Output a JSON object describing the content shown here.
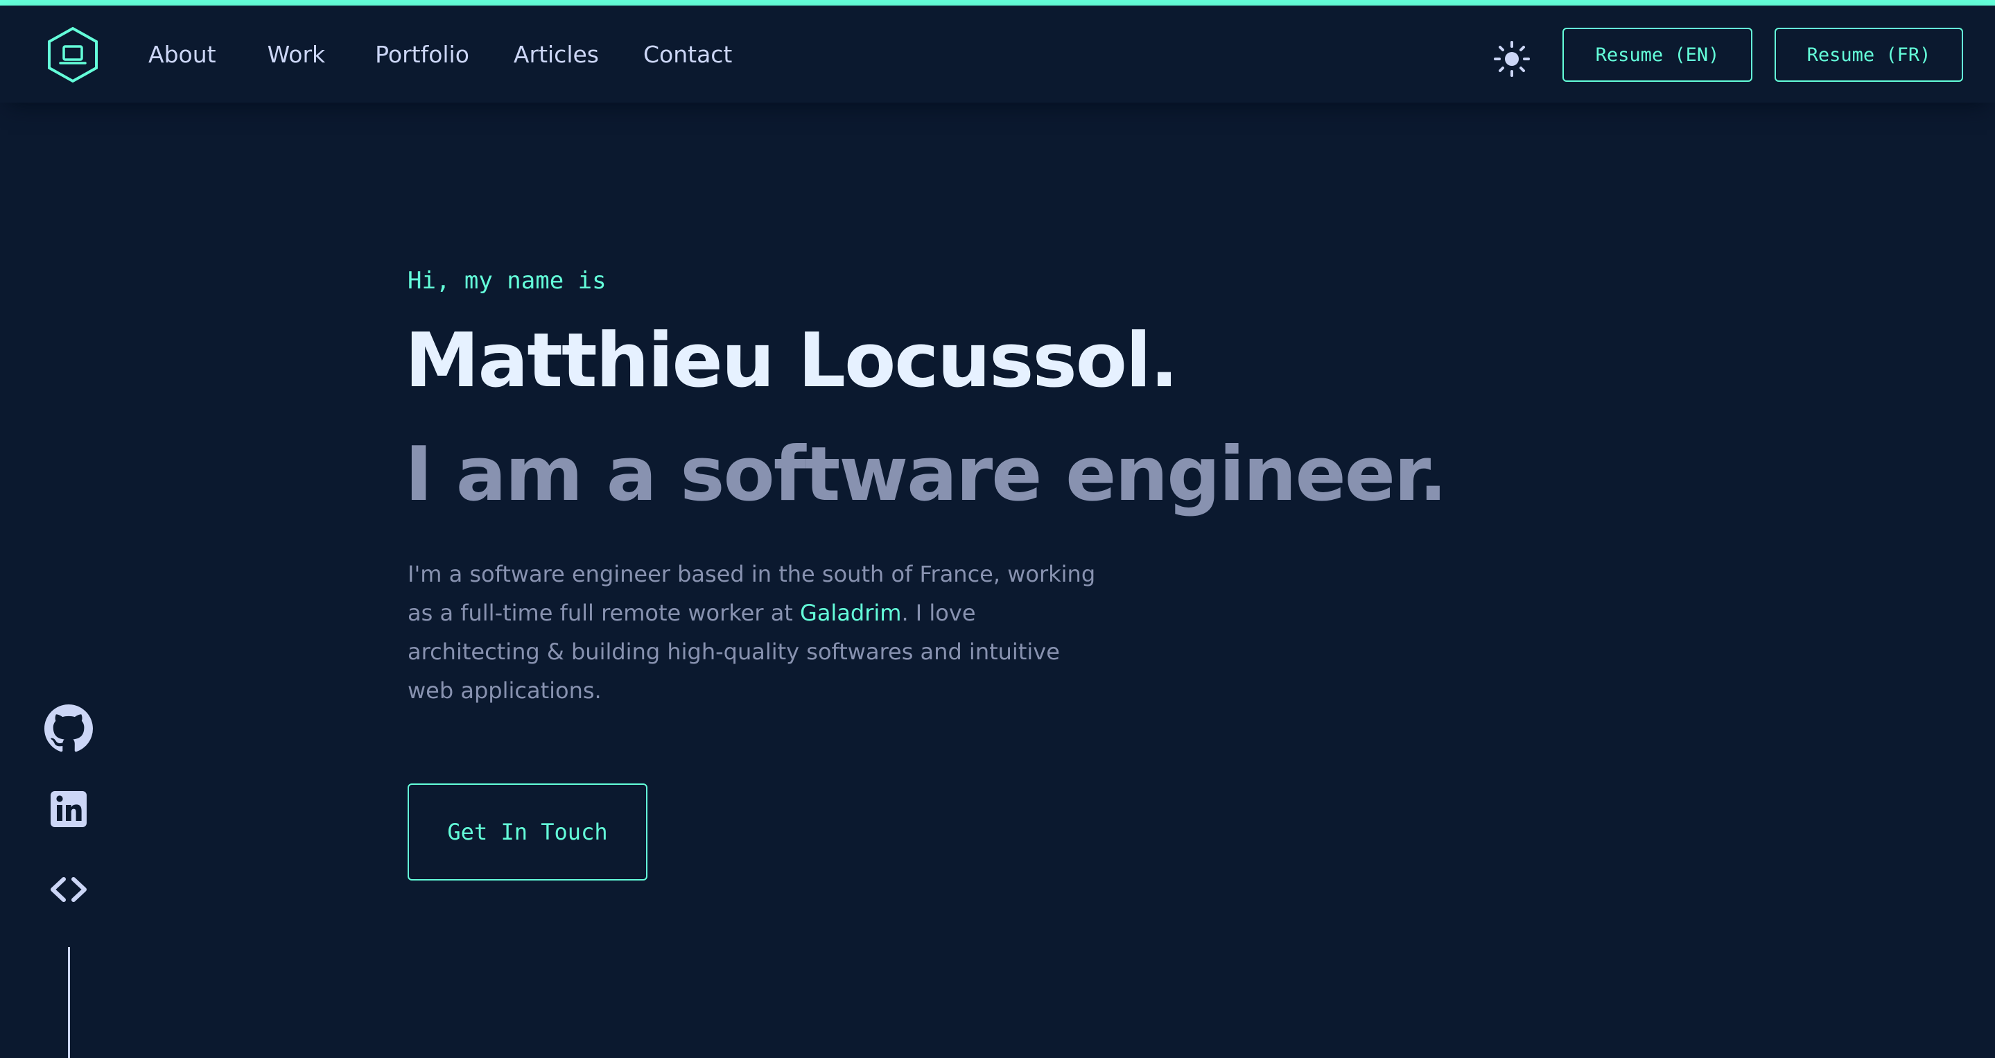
{
  "colors": {
    "background": "#0b192f",
    "accent": "#64ffda",
    "heading": "#e6f1ff",
    "text_light": "#ccd6f6",
    "text_muted": "#8892b0"
  },
  "header": {
    "logo_icon": "laptop-hexagon-icon",
    "nav": {
      "about": "About",
      "work": "Work",
      "portfolio": "Portfolio",
      "articles": "Articles",
      "contact": "Contact"
    },
    "theme_toggle_icon": "sun-icon",
    "resume_en": "Resume (EN)",
    "resume_fr": "Resume (FR)"
  },
  "hero": {
    "greeting": "Hi, my name is",
    "name": "Matthieu Locussol.",
    "tagline": "I am a software engineer.",
    "bio_before_link": "I'm a software engineer based in the south of France, working as a full-time full remote worker at ",
    "bio_link": "Galadrim",
    "bio_after_link": ". I love architecting & building high-quality softwares and intuitive web applications.",
    "cta": "Get In Touch"
  },
  "social": {
    "icons": [
      "github-icon",
      "linkedin-icon",
      "code-icon"
    ]
  }
}
